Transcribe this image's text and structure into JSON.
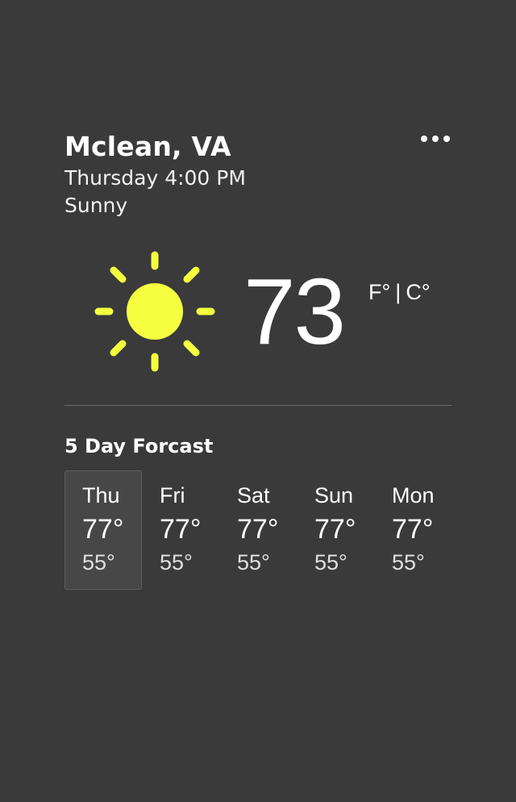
{
  "header": {
    "location": "Mclean, VA",
    "datetime": "Thursday 4:00 PM",
    "condition": "Sunny"
  },
  "menu": {
    "icon": "more-dots-icon"
  },
  "current": {
    "icon": "sun-icon",
    "temperature": "73",
    "unit_f": "F°",
    "unit_separator": "|",
    "unit_c": "C°"
  },
  "forecast": {
    "title": "5 Day Forcast",
    "days": [
      {
        "name": "Thu",
        "high": "77°",
        "low": "55°",
        "selected": true
      },
      {
        "name": "Fri",
        "high": "77°",
        "low": "55°",
        "selected": false
      },
      {
        "name": "Sat",
        "high": "77°",
        "low": "55°",
        "selected": false
      },
      {
        "name": "Sun",
        "high": "77°",
        "low": "55°",
        "selected": false
      },
      {
        "name": "Mon",
        "high": "77°",
        "low": "55°",
        "selected": false
      }
    ]
  },
  "colors": {
    "background": "#3a3a3a",
    "sun": "#f5ff3f",
    "text": "#ffffff",
    "divider": "#6b6b6b",
    "selected_day_bg": "#474747"
  }
}
